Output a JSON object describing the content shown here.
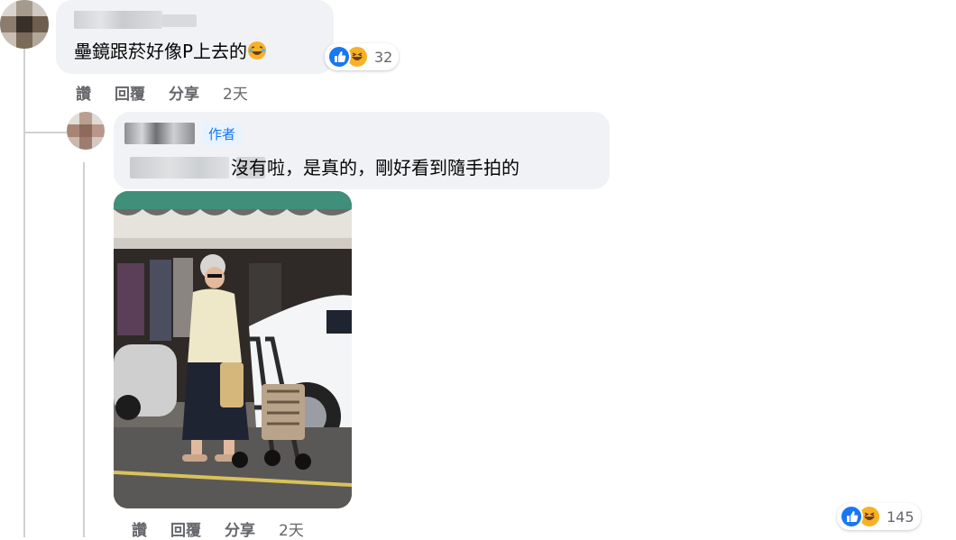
{
  "comment1": {
    "text": "壘鏡跟菸好像P上去的",
    "reaction_count": "32",
    "actions": {
      "like": "讚",
      "reply": "回覆",
      "share": "分享",
      "time": "2天"
    }
  },
  "reply1": {
    "author_badge": "作者",
    "text": "沒有啦，是真的，剛好看到隨手拍的",
    "reaction_count": "145",
    "actions": {
      "like": "讚",
      "reply": "回覆",
      "share": "分享",
      "time": "2天"
    }
  },
  "colors": {
    "bubble": "#f0f2f5",
    "like_blue": "#1877f2",
    "haha_yellow": "#f7b125",
    "meta_gray": "#65676b"
  },
  "icons": [
    "like-reaction-icon",
    "haha-reaction-icon",
    "laughing-emoji-icon"
  ]
}
